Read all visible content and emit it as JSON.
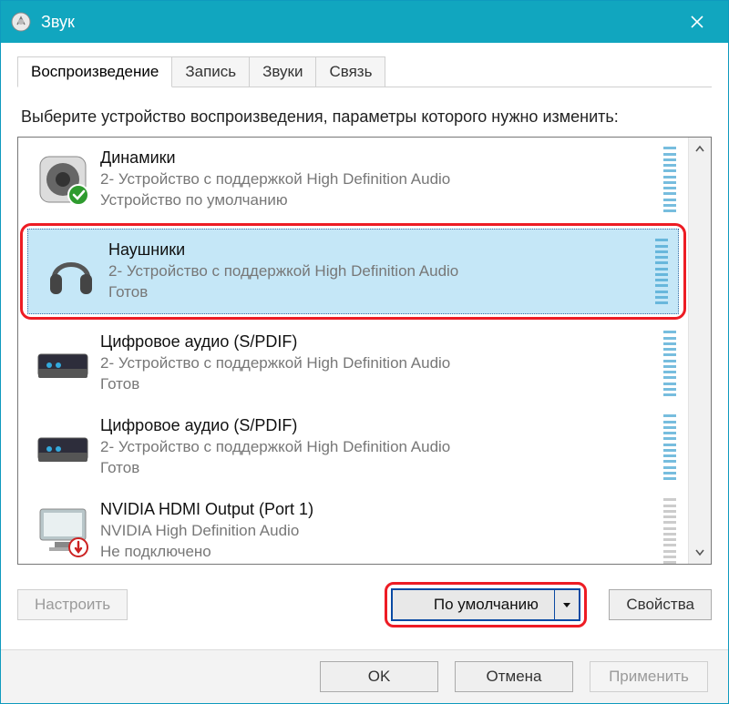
{
  "window": {
    "title": "Звук"
  },
  "tabs": [
    {
      "label": "Воспроизведение",
      "active": true
    },
    {
      "label": "Запись",
      "active": false
    },
    {
      "label": "Звуки",
      "active": false
    },
    {
      "label": "Связь",
      "active": false
    }
  ],
  "instruction": "Выберите устройство воспроизведения, параметры которого нужно изменить:",
  "devices": [
    {
      "name": "Динамики",
      "sub": "2- Устройство с поддержкой High Definition Audio",
      "status": "Устройство по умолчанию",
      "icon": "speaker",
      "default": true,
      "selected": false,
      "connected": true
    },
    {
      "name": "Наушники",
      "sub": "2- Устройство с поддержкой High Definition Audio",
      "status": "Готов",
      "icon": "headphones",
      "default": false,
      "selected": true,
      "connected": true
    },
    {
      "name": "Цифровое аудио (S/PDIF)",
      "sub": "2- Устройство с поддержкой High Definition Audio",
      "status": "Готов",
      "icon": "spdif",
      "default": false,
      "selected": false,
      "connected": true
    },
    {
      "name": "Цифровое аудио (S/PDIF)",
      "sub": "2- Устройство с поддержкой High Definition Audio",
      "status": "Готов",
      "icon": "spdif",
      "default": false,
      "selected": false,
      "connected": true
    },
    {
      "name": "NVIDIA HDMI Output (Port 1)",
      "sub": "NVIDIA High Definition Audio",
      "status": "Не подключено",
      "icon": "monitor",
      "default": false,
      "selected": false,
      "connected": false
    }
  ],
  "buttons": {
    "configure": "Настроить",
    "setDefault": "По умолчанию",
    "properties": "Свойства",
    "ok": "OK",
    "cancel": "Отмена",
    "apply": "Применить"
  },
  "state": {
    "configureEnabled": false,
    "applyEnabled": false
  }
}
